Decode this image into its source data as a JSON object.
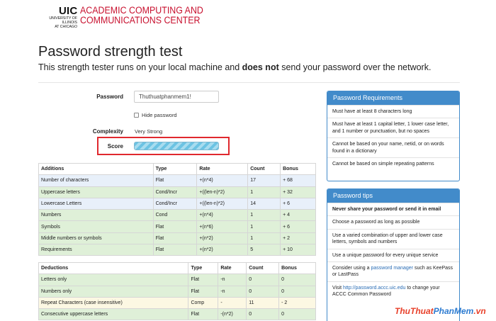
{
  "header": {
    "logo_primary": "UIC",
    "logo_secondary": "UNIVERSITY OF ILLINOIS AT CHICAGO",
    "logo_title_line1": "ACADEMIC COMPUTING AND",
    "logo_title_line2": "COMMUNICATIONS CENTER"
  },
  "page": {
    "title": "Password strength test",
    "subtitle_pre": "This strength tester runs on your local machine and ",
    "subtitle_bold": "does not",
    "subtitle_post": " send your password over the network."
  },
  "form": {
    "password_label": "Password",
    "password_value": "Thuthuatphanmem1!",
    "hide_label": "Hide password",
    "complexity_label": "Complexity",
    "complexity_value": "Very Strong",
    "score_label": "Score",
    "score_fraction": 1.0
  },
  "additions": {
    "headers": [
      "Additions",
      "Type",
      "Rate",
      "Count",
      "Bonus"
    ],
    "rows": [
      {
        "name": "Number of characters",
        "type": "Flat",
        "rate": "+(n*4)",
        "count": "17",
        "bonus": "+ 68",
        "style": "blue"
      },
      {
        "name": "Uppercase letters",
        "type": "Cond/Incr",
        "rate": "+((len-n)*2)",
        "count": "1",
        "bonus": "+ 32",
        "style": "green"
      },
      {
        "name": "Lowercase Letters",
        "type": "Cond/Incr",
        "rate": "+((len-n)*2)",
        "count": "14",
        "bonus": "+ 6",
        "style": "blue"
      },
      {
        "name": "Numbers",
        "type": "Cond",
        "rate": "+(n*4)",
        "count": "1",
        "bonus": "+ 4",
        "style": "green"
      },
      {
        "name": "Symbols",
        "type": "Flat",
        "rate": "+(n*6)",
        "count": "1",
        "bonus": "+ 6",
        "style": "green"
      },
      {
        "name": "Middle numbers or symbols",
        "type": "Flat",
        "rate": "+(n*2)",
        "count": "1",
        "bonus": "+ 2",
        "style": "green"
      },
      {
        "name": "Requirements",
        "type": "Flat",
        "rate": "+(n*2)",
        "count": "5",
        "bonus": "+ 10",
        "style": "green"
      }
    ]
  },
  "deductions": {
    "headers": [
      "Deductions",
      "Type",
      "Rate",
      "Count",
      "Bonus"
    ],
    "rows": [
      {
        "name": "Letters only",
        "type": "Flat",
        "rate": "-n",
        "count": "0",
        "bonus": "0",
        "style": "green"
      },
      {
        "name": "Numbers only",
        "type": "Flat",
        "rate": "-n",
        "count": "0",
        "bonus": "0",
        "style": "green"
      },
      {
        "name": "Repeat Characters (case insensitive)",
        "type": "Comp",
        "rate": "-",
        "count": "11",
        "bonus": "- 2",
        "style": "yellow"
      },
      {
        "name": "Consecutive uppercase letters",
        "type": "Flat",
        "rate": "-(n*2)",
        "count": "0",
        "bonus": "0",
        "style": "green"
      }
    ]
  },
  "requirements_panel": {
    "title": "Password Requirements",
    "items": [
      "Must have at least 8 characters long",
      "Must have at least 1 capital letter, 1 lower case letter, and 1 number or punctuation, but no spaces",
      "Cannot be based on your name, netid, or on words found in a dictionary",
      "Cannot be based on simple repeating patterns"
    ]
  },
  "tips_panel": {
    "title": "Password tips",
    "items": [
      {
        "bold": "Never share your password or send it in email"
      },
      {
        "text": "Choose a password as long as possible"
      },
      {
        "text": "Use a varied combination of upper and lower case letters, symbols and numbers"
      },
      {
        "text": "Use a unique password for every unique service"
      },
      {
        "pre": "Consider using a ",
        "link": "password manager",
        "post": " such as KeePass or LastPass"
      },
      {
        "pre": "Visit ",
        "link": "http://password.accc.uic.edu",
        "post": " to change your ACCC Common Password"
      }
    ]
  },
  "watermark": {
    "part1": "ThuThuat",
    "part2": "PhanMem",
    "part3": ".vn"
  },
  "colors": {
    "accent": "#428bca",
    "brand_red": "#c8102e",
    "highlight_box": "#e0282e",
    "row_green": "#dff0d8",
    "row_blue": "#e8f0fa",
    "row_yellow": "#fcf8e3"
  }
}
